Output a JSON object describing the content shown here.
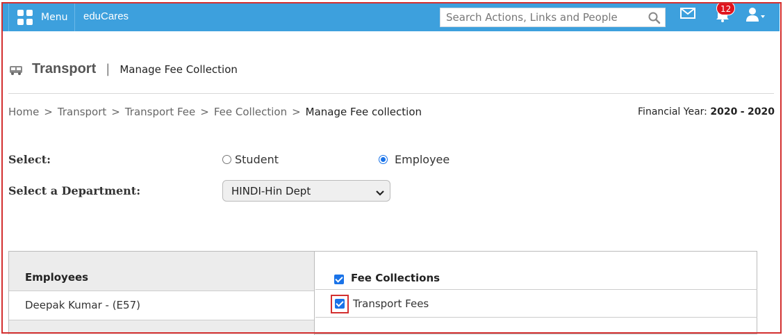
{
  "topbar": {
    "menu_label": "Menu",
    "brand": "eduCares",
    "search_placeholder": "Search Actions, Links and People",
    "notifications_count": "12",
    "icons": [
      "grid-icon",
      "search-icon",
      "mail-icon",
      "bell-icon",
      "user-icon"
    ],
    "color": "#3da0dd"
  },
  "page": {
    "title": "Transport",
    "title_separator": "|",
    "subtitle": "Manage Fee Collection",
    "title_icon": "bus-icon"
  },
  "breadcrumb": {
    "items": [
      "Home",
      "Transport",
      "Transport Fee",
      "Fee Collection"
    ],
    "separator": ">",
    "current": "Manage Fee collection"
  },
  "financial_year": {
    "label": "Financial Year:",
    "start": "2020",
    "separator": "-",
    "end": "2020"
  },
  "form": {
    "select_label": "Select:",
    "options": [
      "Student",
      "Employee"
    ],
    "selected_option": "Employee",
    "department_label": "Select a Department:",
    "department_value": "HINDI-Hin Dept"
  },
  "employees": {
    "header": "Employees",
    "rows": [
      "Deepak Kumar - (E57)"
    ]
  },
  "fee_collections": {
    "header": "Fee Collections",
    "header_checked": true,
    "items": [
      {
        "label": "Transport Fees",
        "checked": true,
        "highlighted": true
      }
    ]
  },
  "colors": {
    "highlight": "#d32f2f",
    "checkbox": "#1a73e8",
    "badge": "#e0141e"
  }
}
